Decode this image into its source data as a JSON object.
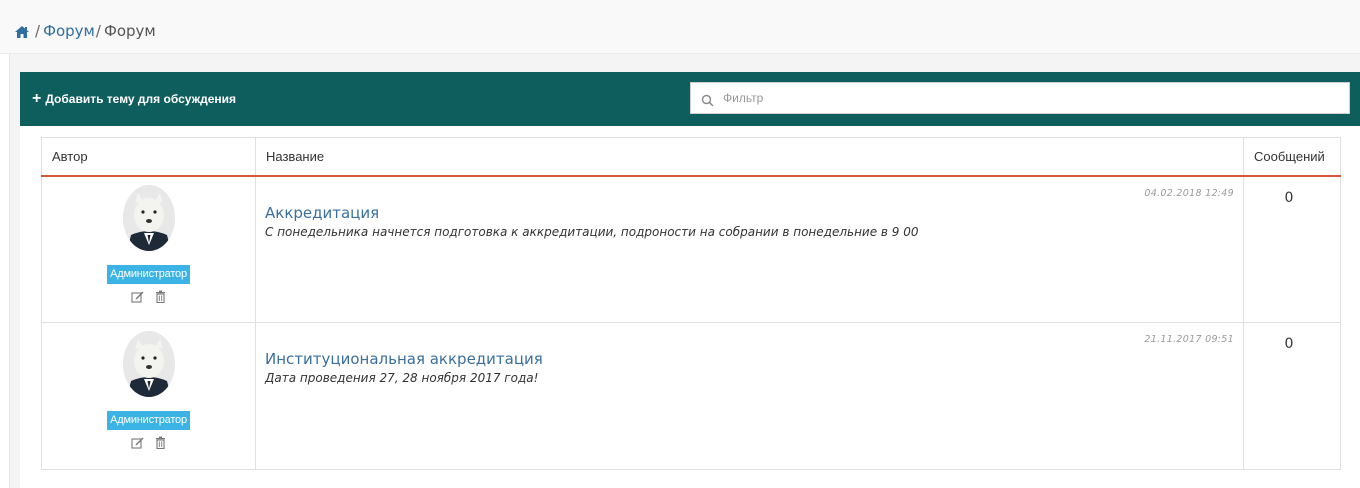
{
  "breadcrumb": {
    "home_icon": "home-icon",
    "separator": "/",
    "link": "Форум",
    "current": "Форум"
  },
  "toolbar": {
    "add_label": "Добавить тему для обсуждения",
    "add_icon": "plus-icon",
    "filter_placeholder": "Фильтр",
    "filter_icon": "search-icon",
    "background_color": "#0f5e5e"
  },
  "table": {
    "headers": {
      "author": "Автор",
      "title": "Название",
      "messages": "Сообщений"
    },
    "header_accent_color": "#d9533b",
    "rows": [
      {
        "role": "Администратор",
        "timestamp": "04.02.2018 12:49",
        "title": "Аккредитация",
        "description": "С понедельника начнется подготовка к аккредитации, подроности на собрании в понедельние в 9 00",
        "messages": "0"
      },
      {
        "role": "Администратор",
        "timestamp": "21.11.2017 09:51",
        "title": "Институциональная аккредитация",
        "description": "Дата проведения 27, 28 ноября 2017 года!",
        "messages": "0"
      }
    ]
  },
  "colors": {
    "badge": "#3bb4e5",
    "link": "#3a6f9c"
  }
}
